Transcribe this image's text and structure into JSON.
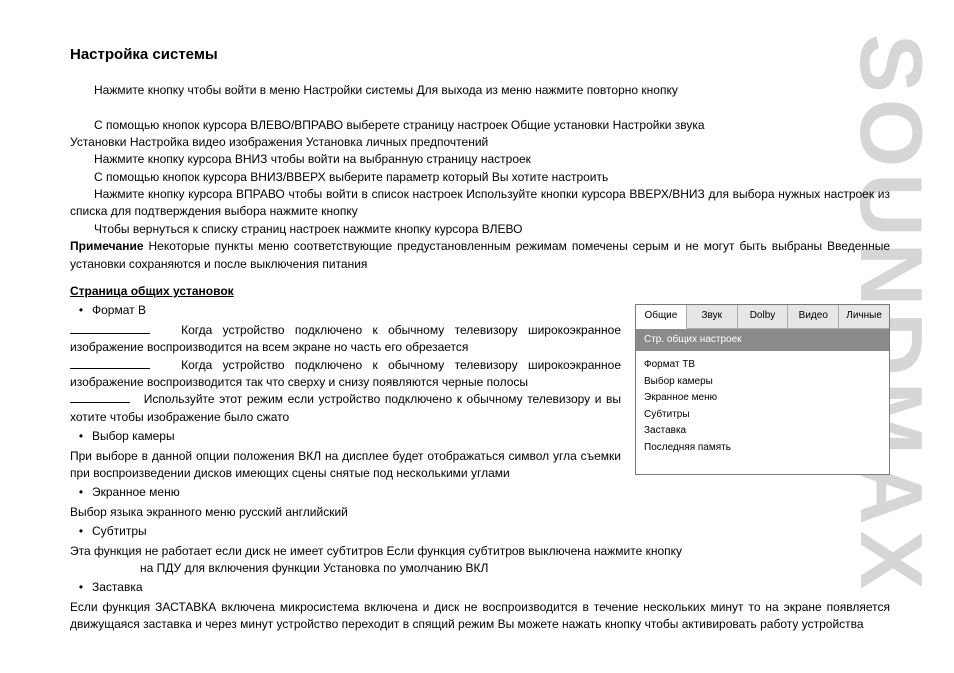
{
  "brand": "SOUNDMAX",
  "title": "Настройка системы",
  "intro_line": "Нажмите кнопку             чтобы войти в меню Настройки системы  Для выхода из меню нажмите повторно кнопку",
  "steps": [
    "С помощью кнопок курсора ВЛЕВО/ВПРАВО выберете страницу настроек  Общие установки  Настройки звука",
    "Установки         Настройка видео  изображения  Установка личных предпочтений",
    "Нажмите кнопку курсора ВНИЗ  чтобы войти на выбранную страницу настроек",
    "С помощью кнопок курсора ВНИЗ/ВВЕРХ выберите параметр  который Вы хотите настроить",
    "Нажмите кнопку курсора ВПРАВО  чтобы войти в список настроек  Используйте кнопки курсора ВВЕРХ/ВНИЗ для выбора нужных настроек из списка  для подтверждения выбора нажмите кнопку",
    "Чтобы вернуться к списку страниц настроек  нажмите кнопку курсора ВЛЕВО"
  ],
  "note_label": "Примечание",
  "note_text": "Некоторые пункты меню  соответствующие предустановленным режимам  помечены серым и не могут быть выбраны  Введенные установки сохраняются и после выключения питания",
  "section_heading": "Страница общих установок",
  "bullets": {
    "format_tv": "Формат  В",
    "format_p1": "Когда устройство подключено к обычному телевизору  широкоэкранное изображение воспроизводится на всем экране  но часть его обрезается",
    "format_p2": "Когда устройство подключено к обычному телевизору  широкоэкранное изображение воспроизводится так  что сверху и снизу появляются черные полосы",
    "format_p3": "Используйте этот режим  если устройство подключено к обычному телевизору  и вы хотите  чтобы изображение было сжато",
    "camera": "Выбор камеры",
    "camera_text": "При выборе в данной опции положения ВКЛ на дисплее будет отображаться символ угла съемки при воспроизведении дисков  имеющих сцены  снятые под несколькими углами",
    "osd": "Экранное меню",
    "osd_text": "Выбор языка экранного меню  русский  английский",
    "subs": "Субтитры",
    "subs_text1": "Эта функция не работает  если диск не имеет субтитров  Если функция субтитров выключена  нажмите кнопку",
    "subs_text2": "на ПДУ для включения функции  Установка по умолчанию   ВКЛ",
    "saver": "Заставка",
    "saver_text": "Если функция ЗАСТАВКА включена  микросистема включена и диск не воспроизводится в течение нескольких минут  то на экране появляется движущаяся заставка и через     минут устройство переходит в спящий режим  Вы можете нажать кнопку                  чтобы активировать работу устройства"
  },
  "settings": {
    "tabs": [
      "Общие",
      "Звук",
      "Dolby",
      "Видео",
      "Личные"
    ],
    "subhead": "Стр. общих настроек",
    "items": [
      "Формат ТВ",
      "Выбор камеры",
      "Экранное меню",
      "Субтитры",
      "Заставка",
      "Последняя память"
    ]
  }
}
